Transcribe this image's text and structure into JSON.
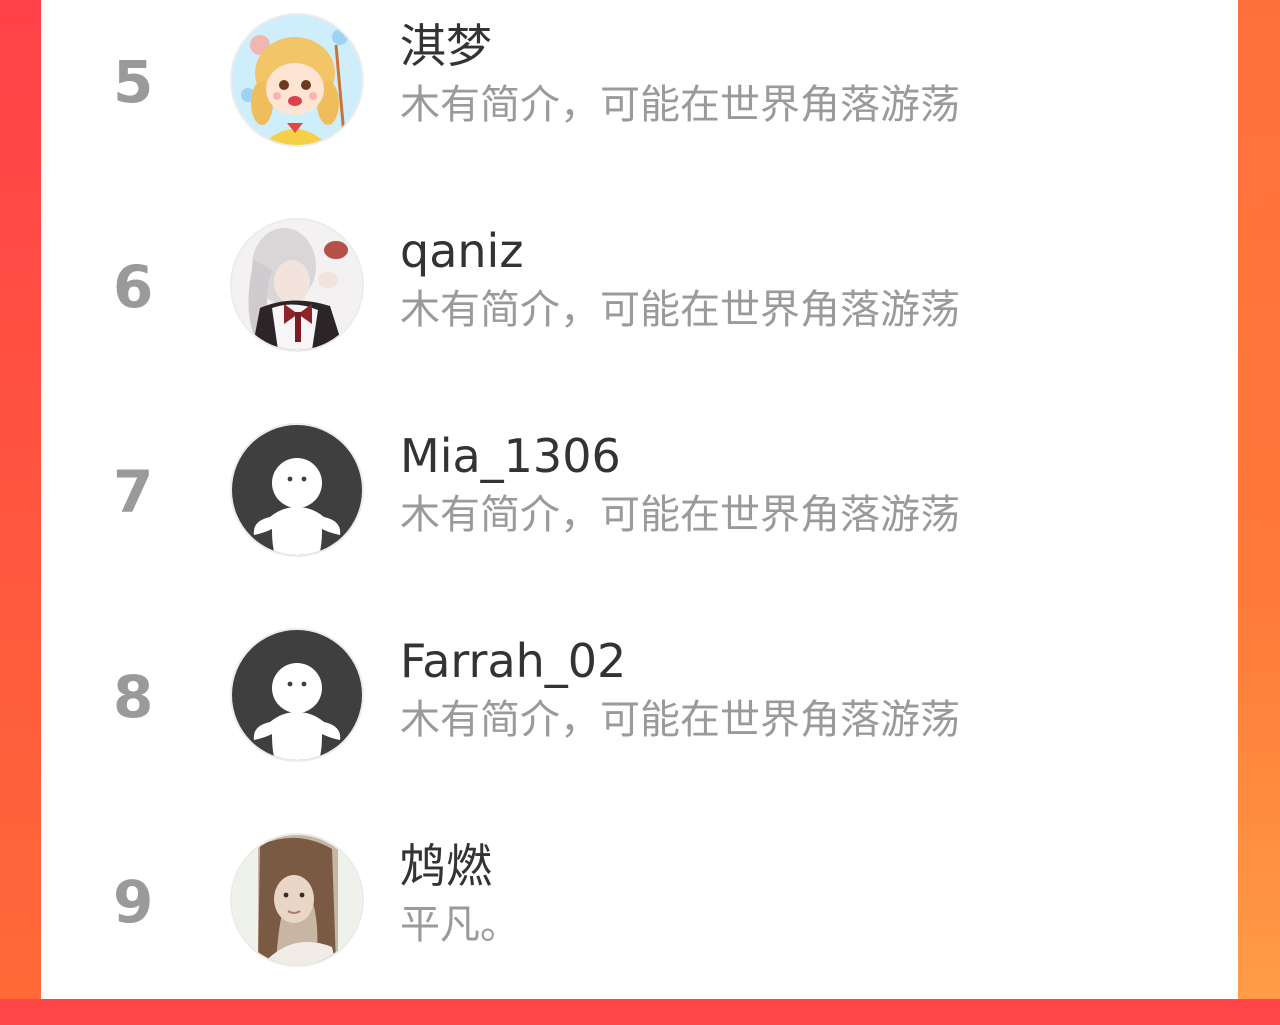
{
  "colors": {
    "accent_top": "#ff4548",
    "accent_bottom": "#ff9a45",
    "card_background": "#ffffff",
    "rank_color": "#9a9a9a",
    "name_color": "#333333",
    "bio_color": "#9a9a9a",
    "default_avatar_bg": "#3f3f3f"
  },
  "ranking": {
    "items": [
      {
        "rank": "5",
        "name": "淇梦",
        "bio": "木有简介，可能在世界角落游荡",
        "avatar": "cartoon-girl-avatar"
      },
      {
        "rank": "6",
        "name": "qaniz",
        "bio": "木有简介，可能在世界角落游荡",
        "avatar": "maid-girl-avatar"
      },
      {
        "rank": "7",
        "name": "Mia_1306",
        "bio": "木有简介，可能在世界角落游荡",
        "avatar": "default-avatar"
      },
      {
        "rank": "8",
        "name": "Farrah_02",
        "bio": "木有简介，可能在世界角落游荡",
        "avatar": "default-avatar"
      },
      {
        "rank": "9",
        "name": "鸩燃",
        "bio": "平凡。",
        "avatar": "photo-girl-avatar"
      }
    ]
  }
}
